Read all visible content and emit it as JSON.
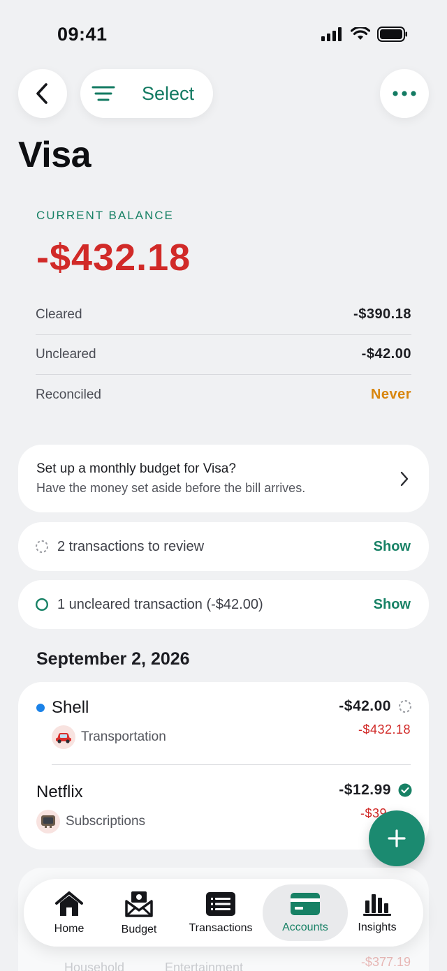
{
  "status_bar": {
    "time": "09:41"
  },
  "nav": {
    "select_label": "Select"
  },
  "page_title": "Visa",
  "balance": {
    "label": "CURRENT BALANCE",
    "amount": "-$432.18",
    "rows": [
      {
        "label": "Cleared",
        "value": "-$390.18"
      },
      {
        "label": "Uncleared",
        "value": "-$42.00"
      },
      {
        "label": "Reconciled",
        "value": "Never"
      }
    ]
  },
  "budget_prompt": {
    "title": "Set up a monthly budget for Visa?",
    "subtitle": "Have the money set aside before the bill arrives."
  },
  "review_banner": {
    "text": "2 transactions to review",
    "action": "Show"
  },
  "uncleared_banner": {
    "text": "1 uncleared transaction (-$42.00)",
    "action": "Show"
  },
  "date_header": "September 2, 2026",
  "transactions": [
    {
      "payee": "Shell",
      "category": "Transportation",
      "category_icon": "car-emoji",
      "amount": "-$42.00",
      "running_balance": "-$432.18",
      "status": "pending"
    },
    {
      "payee": "Netflix",
      "category": "Subscriptions",
      "category_icon": "tv-emoji",
      "amount": "-$12.99",
      "running_balance": "-$39",
      "status": "cleared"
    }
  ],
  "ghost_rows": {
    "categories": [
      "Household",
      "Entertainment"
    ],
    "amount": "-$377.19"
  },
  "tabbar": {
    "items": [
      {
        "label": "Home",
        "icon": "house-icon"
      },
      {
        "label": "Budget",
        "icon": "envelope-icon"
      },
      {
        "label": "Transactions",
        "icon": "list-icon"
      },
      {
        "label": "Accounts",
        "icon": "card-icon",
        "active": true
      },
      {
        "label": "Insights",
        "icon": "bar-chart-icon"
      }
    ]
  },
  "colors": {
    "accent": "#178165",
    "negative": "#d12a28",
    "warning": "#d8860e",
    "pending_dot": "#1b82e8",
    "background": "#f0f1f3"
  }
}
